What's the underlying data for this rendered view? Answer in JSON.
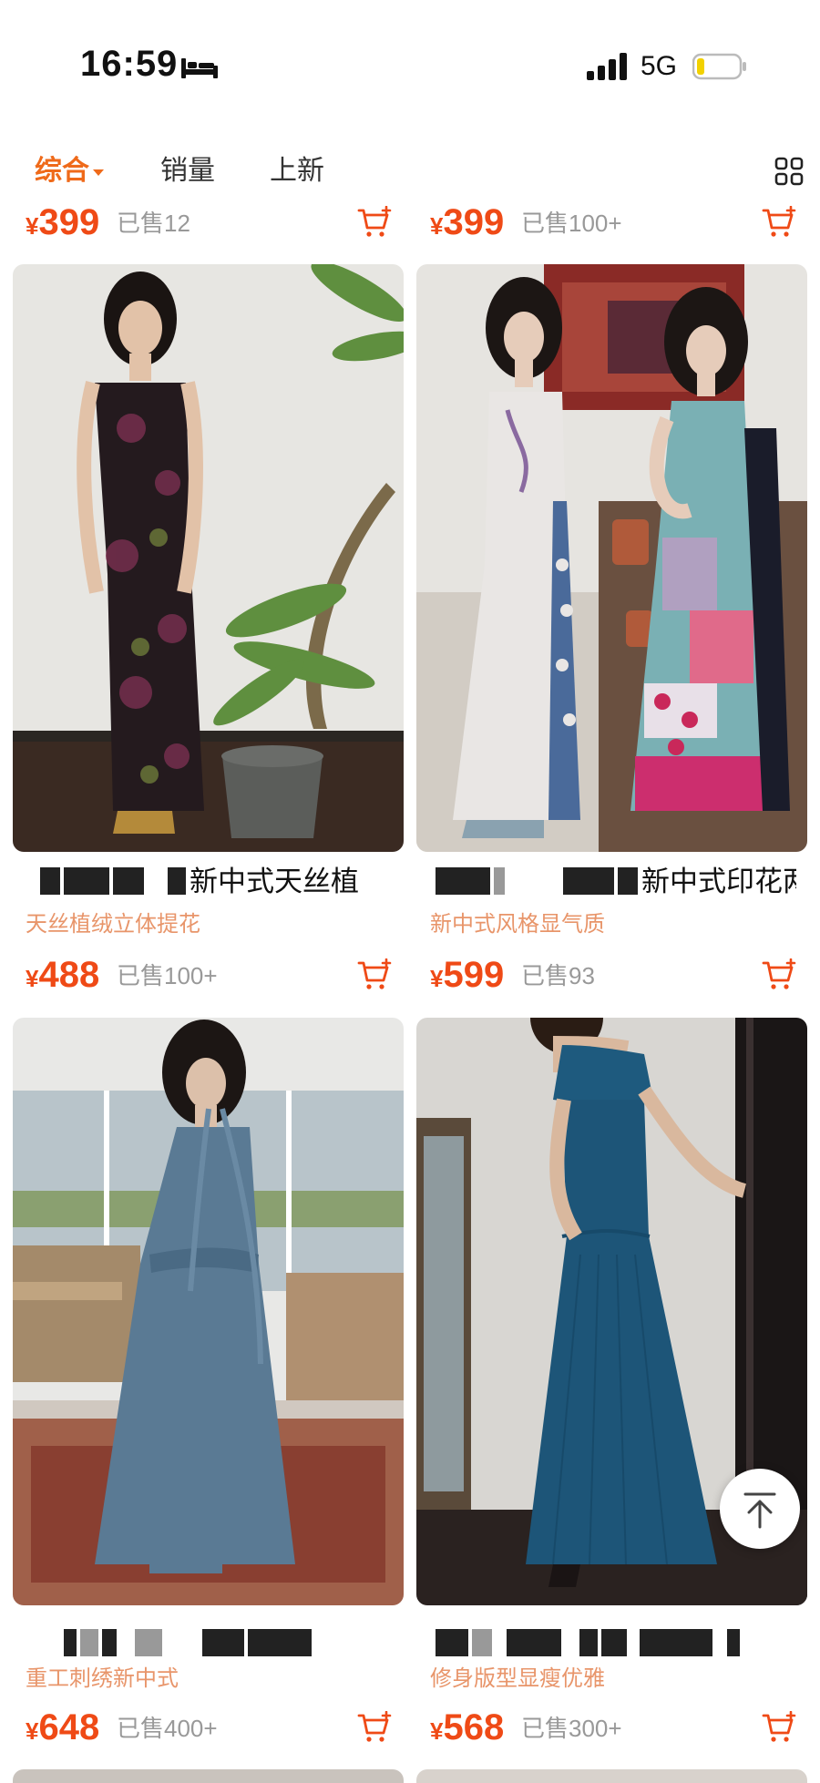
{
  "status_bar": {
    "time": "16:59",
    "network": "5G"
  },
  "sort_bar": {
    "tabs": [
      {
        "label": "综合"
      },
      {
        "label": "销量"
      },
      {
        "label": "上新"
      }
    ]
  },
  "colors": {
    "accent": "#ef6a1a",
    "price": "#ef4a16",
    "tag": "#e8956a"
  },
  "top_row": [
    {
      "price": "399",
      "sold": "已售12"
    },
    {
      "price": "399",
      "sold": "已售100+"
    }
  ],
  "products": [
    {
      "title": "新中式天丝植",
      "tag": "天丝植绒立体提花",
      "price": "488",
      "sold": "已售100+",
      "image": "black-floral-strapless-dress"
    },
    {
      "title": "新中式印花两",
      "tag": "新中式风格显气质",
      "price": "599",
      "sold": "已售93",
      "image": "white-and-patchwork-printed-dresses"
    },
    {
      "title": "",
      "tag": "重工刺绣新中式",
      "price": "648",
      "sold": "已售400+",
      "image": "blue-grey-strapless-maxi-dress"
    },
    {
      "title": "",
      "tag": "修身版型显瘦优雅",
      "price": "568",
      "sold": "已售300+",
      "image": "teal-off-shoulder-maxi-dress"
    }
  ],
  "currency": "¥"
}
